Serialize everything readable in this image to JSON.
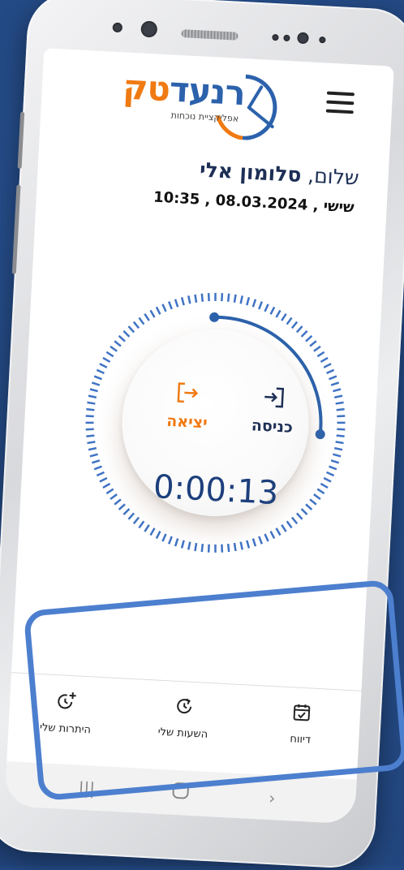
{
  "header": {
    "logo_main_orange": "טק",
    "logo_main_blue": "רנעד",
    "logo_sub": "אפליקציית נוכחות",
    "menu_icon": "hamburger-icon"
  },
  "greeting": {
    "hello": "שלום,",
    "name": "סלומון אלי"
  },
  "datetime": "שישי , 08.03.2024 , 10:35",
  "clock": {
    "exit_label": "יציאה",
    "enter_label": "כניסה",
    "exit_icon": "logout-icon",
    "enter_icon": "login-icon",
    "elapsed": "0:00:13",
    "progress_fraction": 0.25
  },
  "bottom_nav": {
    "items": [
      {
        "label": "דיווח",
        "icon": "calendar-check-icon"
      },
      {
        "label": "השעות שלי",
        "icon": "clock-refresh-icon"
      },
      {
        "label": "היתרות שלי",
        "icon": "clock-plus-icon"
      }
    ]
  },
  "colors": {
    "accent_orange": "#f07a12",
    "accent_blue": "#2c62ac",
    "dark_navy": "#1d2f55",
    "highlight_blue": "#4d7fcf"
  }
}
